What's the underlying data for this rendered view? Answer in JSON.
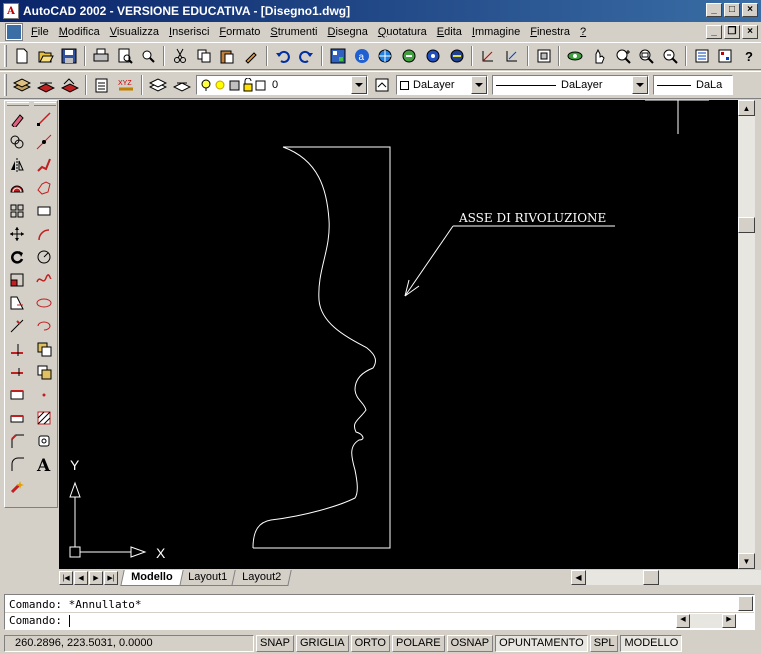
{
  "window": {
    "title": "AutoCAD 2002 - VERSIONE EDUCATIVA - [Disegno1.dwg]",
    "app_glyph": "A"
  },
  "menu": {
    "items": [
      {
        "label": "File",
        "accel": "F",
        "rest": "ile"
      },
      {
        "label": "Modifica",
        "accel": "M",
        "rest": "odifica"
      },
      {
        "label": "Visualizza",
        "accel": "V",
        "rest": "isualizza"
      },
      {
        "label": "Inserisci",
        "accel": "I",
        "rest": "nserisci"
      },
      {
        "label": "Formato",
        "accel": "F",
        "rest": "ormato"
      },
      {
        "label": "Strumenti",
        "accel": "S",
        "rest": "trumenti"
      },
      {
        "label": "Disegna",
        "accel": "D",
        "rest": "isegna"
      },
      {
        "label": "Quotatura",
        "accel": "Q",
        "rest": "uotatura"
      },
      {
        "label": "Edita",
        "accel": "E",
        "rest": "dita"
      },
      {
        "label": "Immagine",
        "accel": "I",
        "rest": "mmagine"
      },
      {
        "label": "Finestra",
        "accel": "F",
        "rest": "inestra"
      },
      {
        "label": "?",
        "accel": "?",
        "rest": ""
      }
    ]
  },
  "layer_toolbar": {
    "layer_name": "0",
    "color": "DaLayer",
    "linetype": "DaLayer",
    "lineweight": "DaLa"
  },
  "drawing": {
    "annotation": "ASSE DI RIVOLUZIONE",
    "ucs_x": "X",
    "ucs_y": "Y",
    "background": "#000000",
    "line_color": "#ffffff"
  },
  "tabs": [
    "Modello",
    "Layout1",
    "Layout2"
  ],
  "active_tab": "Modello",
  "command": {
    "history": "Comando: *Annullato*",
    "prompt": "Comando:"
  },
  "status": {
    "coords": "260.2896, 223.5031, 0.0000",
    "toggles": [
      "SNAP",
      "GRIGLIA",
      "ORTO",
      "POLARE",
      "OSNAP",
      "OPUNTAMENTO",
      "SPL",
      "MODELLO"
    ],
    "active_toggles": [
      "OPUNTAMENTO",
      "MODELLO"
    ]
  }
}
